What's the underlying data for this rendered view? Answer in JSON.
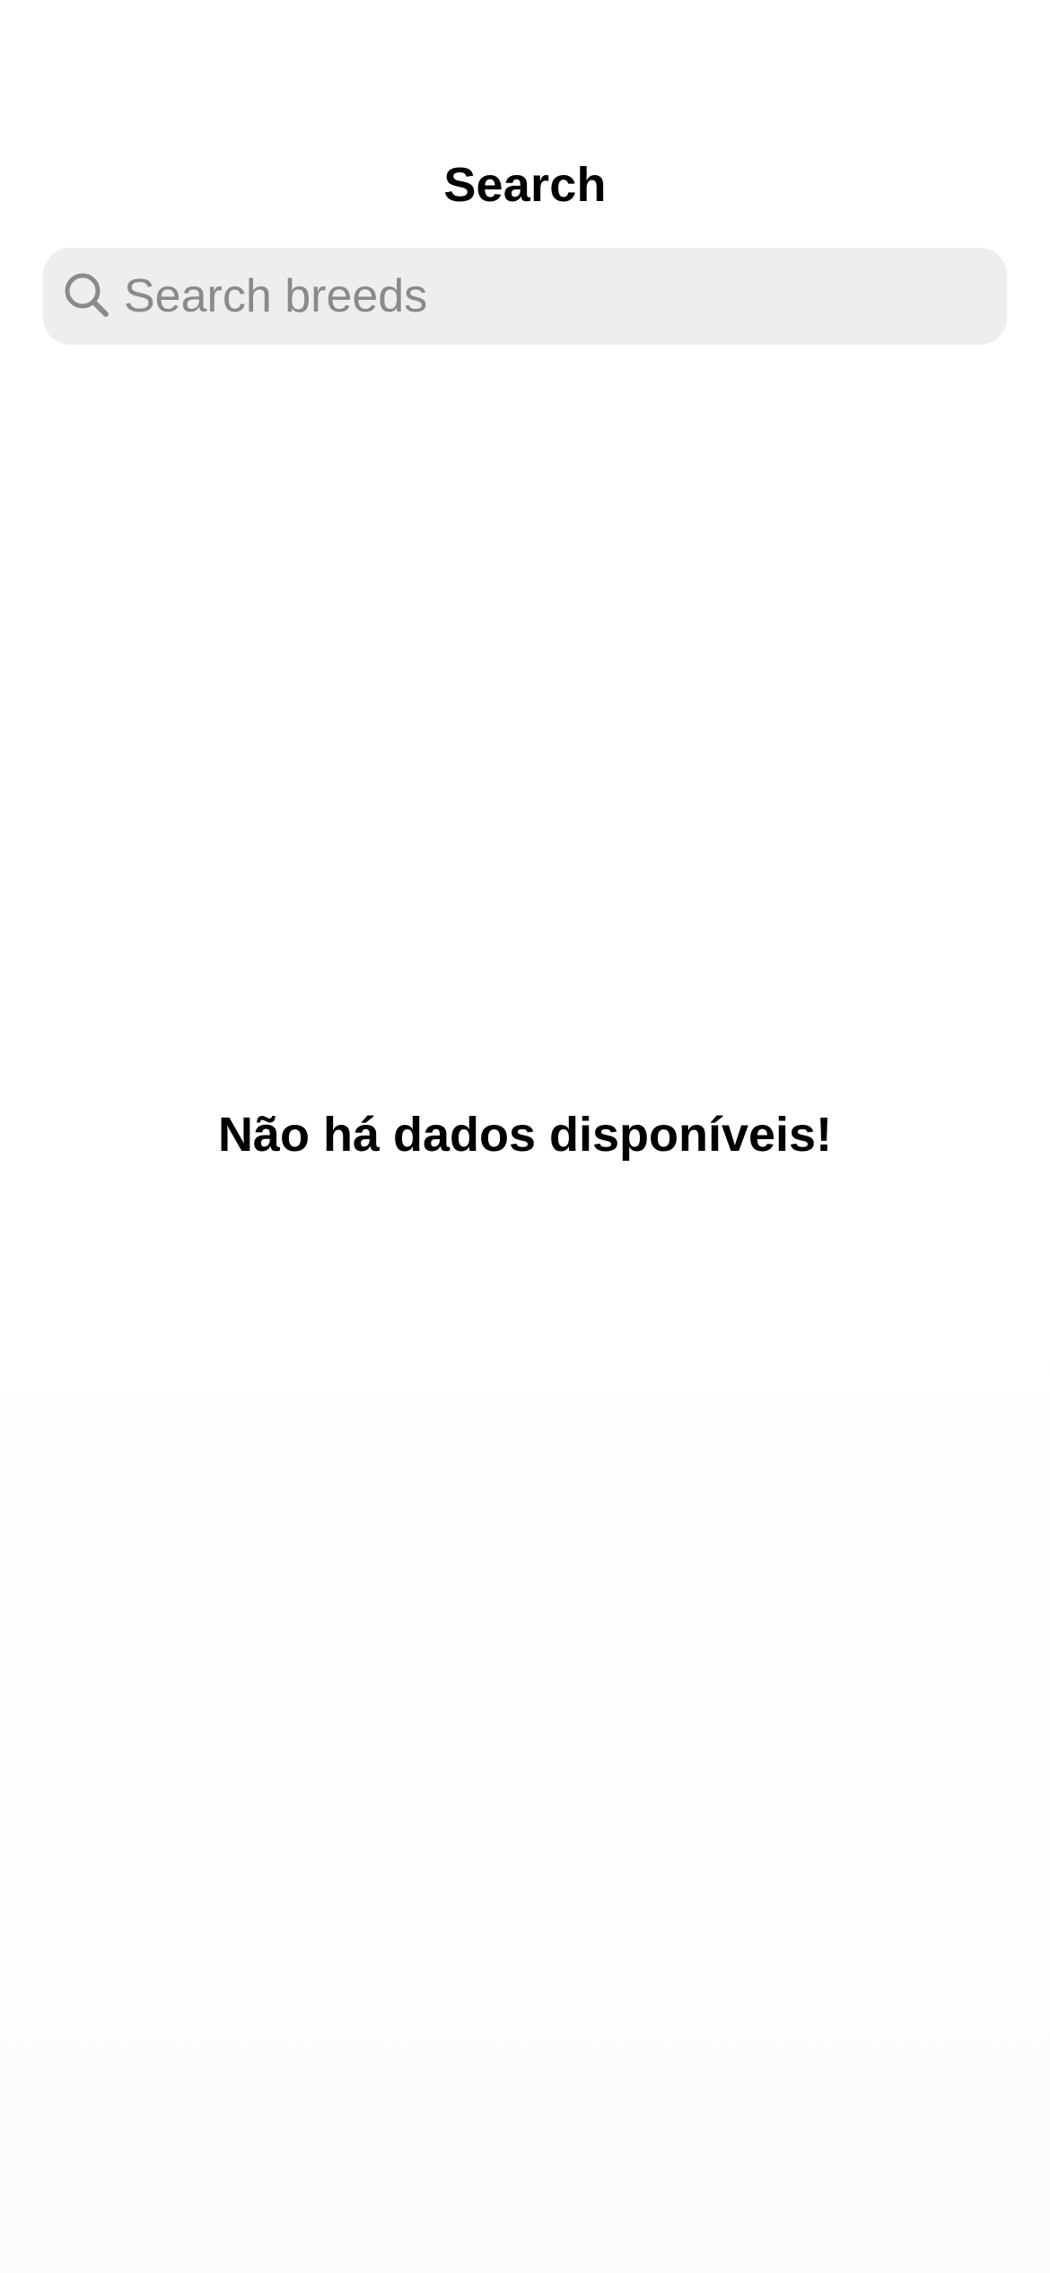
{
  "header": {
    "title": "Search"
  },
  "search": {
    "placeholder": "Search breeds",
    "value": "",
    "icon": "magnifying-glass-icon"
  },
  "main": {
    "empty_message": "Não há dados disponíveis!"
  },
  "colors": {
    "background": "#ffffff",
    "search_bar_background": "#eeeeee",
    "placeholder": "#8a8a8e",
    "icon": "#8a8a8e",
    "text": "#000000"
  }
}
